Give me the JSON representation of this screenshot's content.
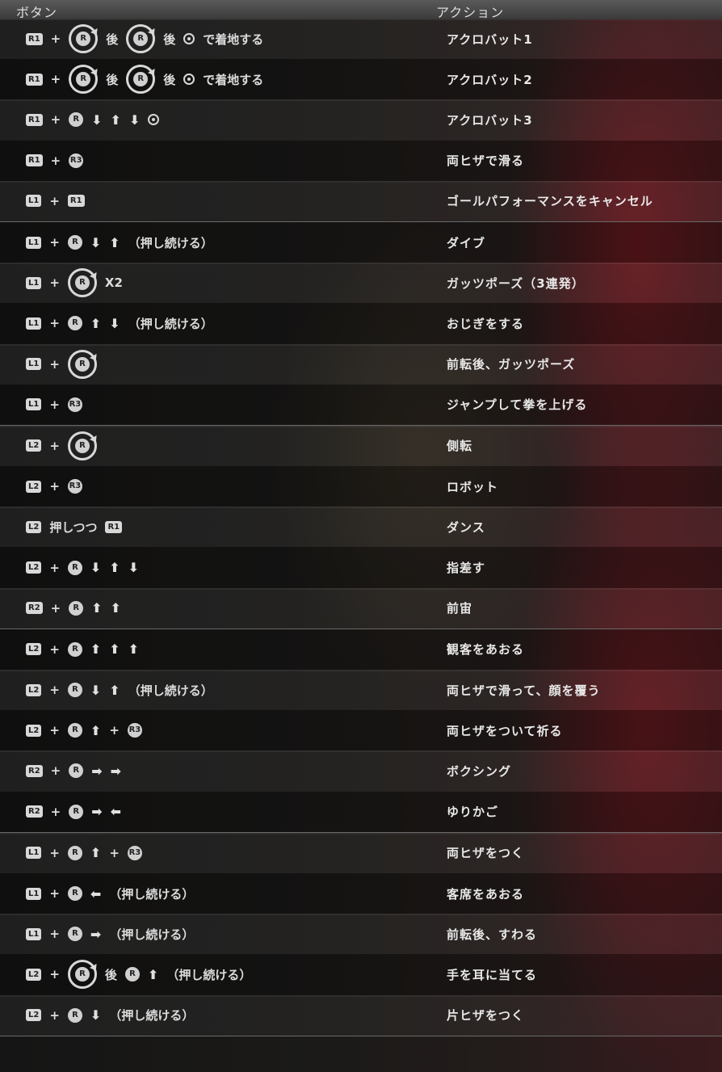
{
  "header": {
    "button_col": "ボタン",
    "action_col": "アクション"
  },
  "groups": [
    {
      "rows": [
        {
          "combo": [
            "btn:R1",
            "+",
            "rot:R",
            "後",
            "rot:R",
            "後",
            "circle",
            "で着地する"
          ],
          "action": "アクロバット1"
        },
        {
          "combo": [
            "btn:R1",
            "+",
            "rot:R",
            "後",
            "rot:R",
            "後",
            "circle",
            "で着地する"
          ],
          "action": "アクロバット2"
        },
        {
          "combo": [
            "btn:R1",
            "+",
            "stick:R",
            "down",
            "up",
            "down",
            "circle"
          ],
          "action": "アクロバット3"
        },
        {
          "combo": [
            "btn:R1",
            "+",
            "stick:R3"
          ],
          "action": "両ヒザで滑る"
        },
        {
          "combo": [
            "btn:L1",
            "+",
            "btn:R1"
          ],
          "action": "ゴールパフォーマンスをキャンセル"
        }
      ]
    },
    {
      "rows": [
        {
          "combo": [
            "btn:L1",
            "+",
            "stick:R",
            "down",
            "up",
            "（押し続ける）"
          ],
          "action": "ダイブ"
        },
        {
          "combo": [
            "btn:L1",
            "+",
            "rot:R",
            "X2"
          ],
          "action": "ガッツポーズ（3連発）"
        },
        {
          "combo": [
            "btn:L1",
            "+",
            "stick:R",
            "up",
            "down",
            "（押し続ける）"
          ],
          "action": "おじぎをする"
        },
        {
          "combo": [
            "btn:L1",
            "+",
            "rot:R"
          ],
          "action": "前転後、ガッツポーズ"
        },
        {
          "combo": [
            "btn:L1",
            "+",
            "stick:R3"
          ],
          "action": "ジャンプして拳を上げる"
        }
      ]
    },
    {
      "rows": [
        {
          "combo": [
            "btn:L2",
            "+",
            "rot:R"
          ],
          "action": "側転"
        },
        {
          "combo": [
            "btn:L2",
            "+",
            "stick:R3"
          ],
          "action": "ロボット"
        },
        {
          "combo": [
            "btn:L2",
            "押しつつ",
            "btn:R1"
          ],
          "action": "ダンス"
        },
        {
          "combo": [
            "btn:L2",
            "+",
            "stick:R",
            "down",
            "up",
            "down"
          ],
          "action": "指差す"
        },
        {
          "combo": [
            "btn:R2",
            "+",
            "stick:R",
            "up",
            "up"
          ],
          "action": "前宙"
        }
      ]
    },
    {
      "rows": [
        {
          "combo": [
            "btn:L2",
            "+",
            "stick:R",
            "up",
            "up",
            "up"
          ],
          "action": "観客をあおる"
        },
        {
          "combo": [
            "btn:L2",
            "+",
            "stick:R",
            "down",
            "up",
            "（押し続ける）"
          ],
          "action": "両ヒザで滑って、顔を覆う"
        },
        {
          "combo": [
            "btn:L2",
            "+",
            "stick:R",
            "up",
            "+",
            "stick:R3"
          ],
          "action": "両ヒザをついて祈る"
        },
        {
          "combo": [
            "btn:R2",
            "+",
            "stick:R",
            "right",
            "right"
          ],
          "action": "ボクシング"
        },
        {
          "combo": [
            "btn:R2",
            "+",
            "stick:R",
            "right",
            "left"
          ],
          "action": "ゆりかご"
        }
      ]
    },
    {
      "rows": [
        {
          "combo": [
            "btn:L1",
            "+",
            "stick:R",
            "up",
            "+",
            "stick:R3"
          ],
          "action": "両ヒザをつく"
        },
        {
          "combo": [
            "btn:L1",
            "+",
            "stick:R",
            "left",
            "（押し続ける）"
          ],
          "action": "客席をあおる"
        },
        {
          "combo": [
            "btn:L1",
            "+",
            "stick:R",
            "right",
            "（押し続ける）"
          ],
          "action": "前転後、すわる"
        },
        {
          "combo": [
            "btn:L2",
            "+",
            "rot:R",
            "後",
            "stick:R",
            "up",
            "（押し続ける）"
          ],
          "action": "手を耳に当てる"
        },
        {
          "combo": [
            "btn:L2",
            "+",
            "stick:R",
            "down",
            "（押し続ける）"
          ],
          "action": "片ヒザをつく"
        }
      ]
    }
  ]
}
